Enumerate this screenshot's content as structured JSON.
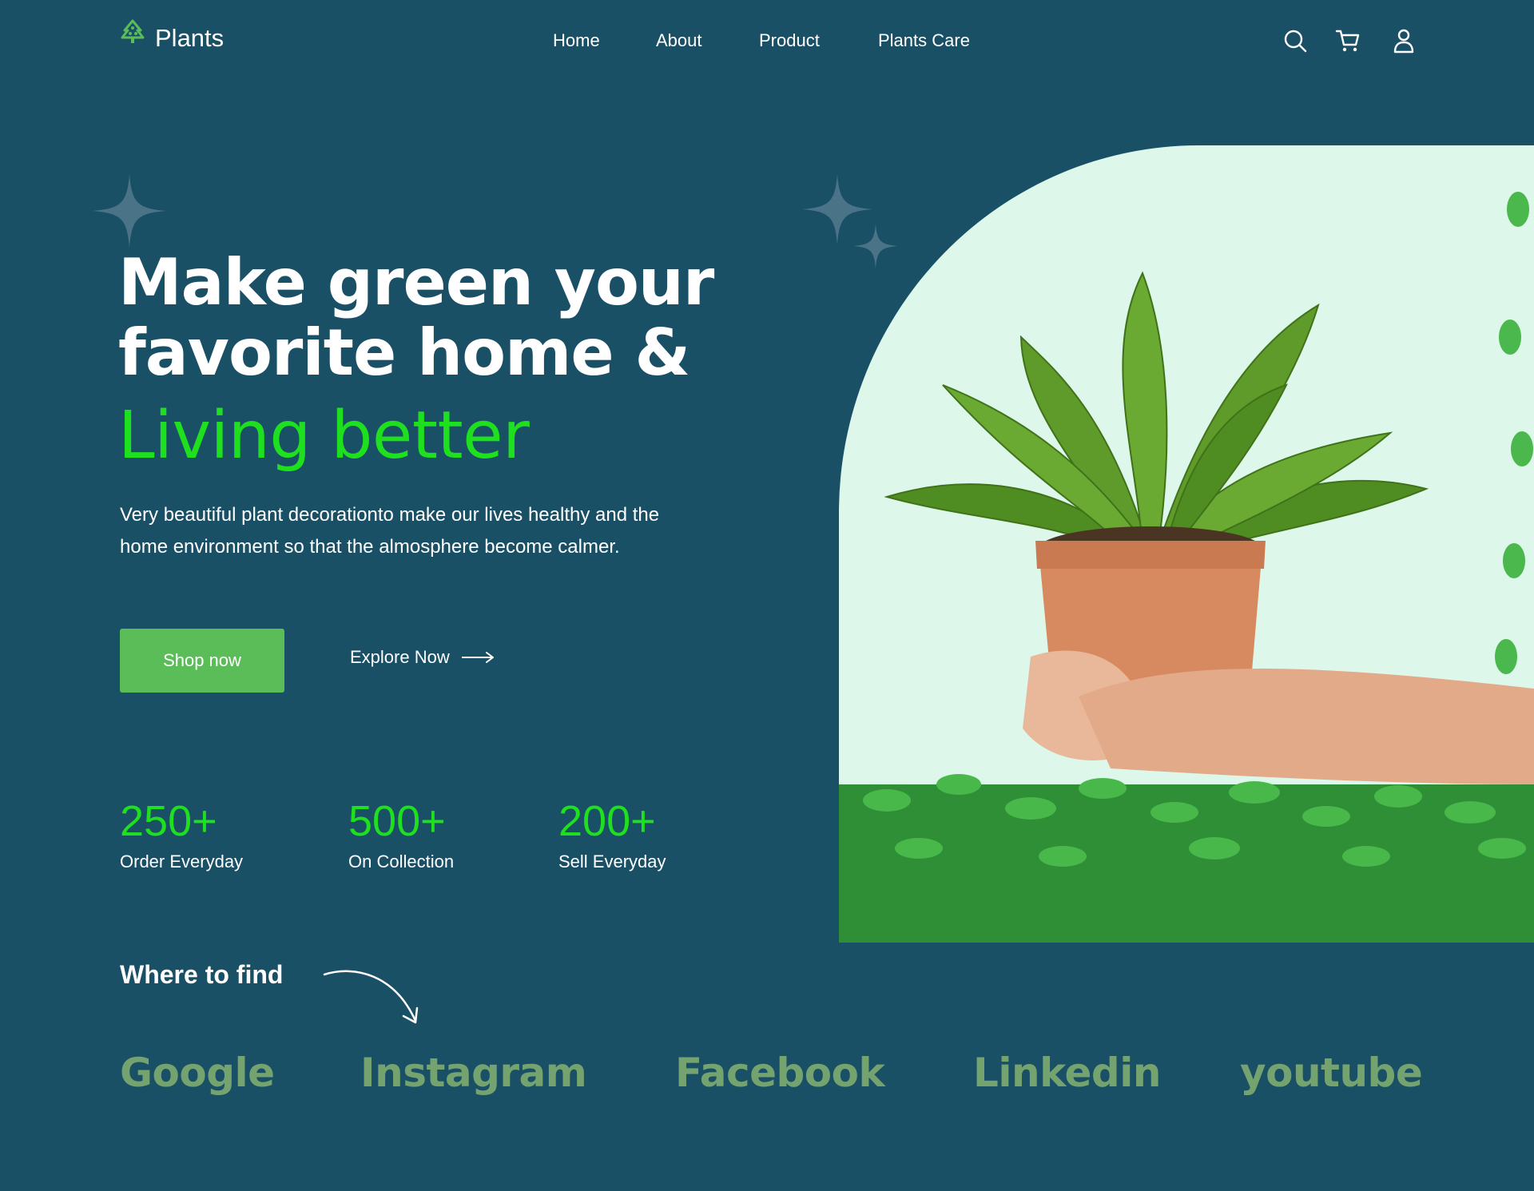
{
  "brand": {
    "name": "Plants",
    "icon": "tree-icon",
    "accent": "#5bbd57"
  },
  "nav": {
    "links": [
      "Home",
      "About",
      "Product",
      "Plants Care"
    ],
    "icons": [
      "search-icon",
      "cart-icon",
      "user-icon"
    ]
  },
  "hero": {
    "title_lines": [
      "Make green your",
      "favorite home &"
    ],
    "accent_line": "Living better",
    "accent_color": "#1ee01e",
    "description": "Very beautiful plant decorationto make our lives healthy and the home environment so that the almosphere become calmer.",
    "primary_button": "Shop now",
    "secondary_button": "Explore Now"
  },
  "stats": [
    {
      "value": "250+",
      "label": "Order Everyday"
    },
    {
      "value": "500+",
      "label": "On Collection"
    },
    {
      "value": "200+",
      "label": "Sell Everyday"
    }
  ],
  "where_to_find": {
    "title": "Where to find",
    "platforms": [
      "Google",
      "Instagram",
      "Facebook",
      "Linkedin",
      "youtube"
    ],
    "platform_color": "#74a36f"
  },
  "colors": {
    "background": "#1a5066",
    "image_bg": "#ddf7ea",
    "sparkle": "#4a7388"
  }
}
